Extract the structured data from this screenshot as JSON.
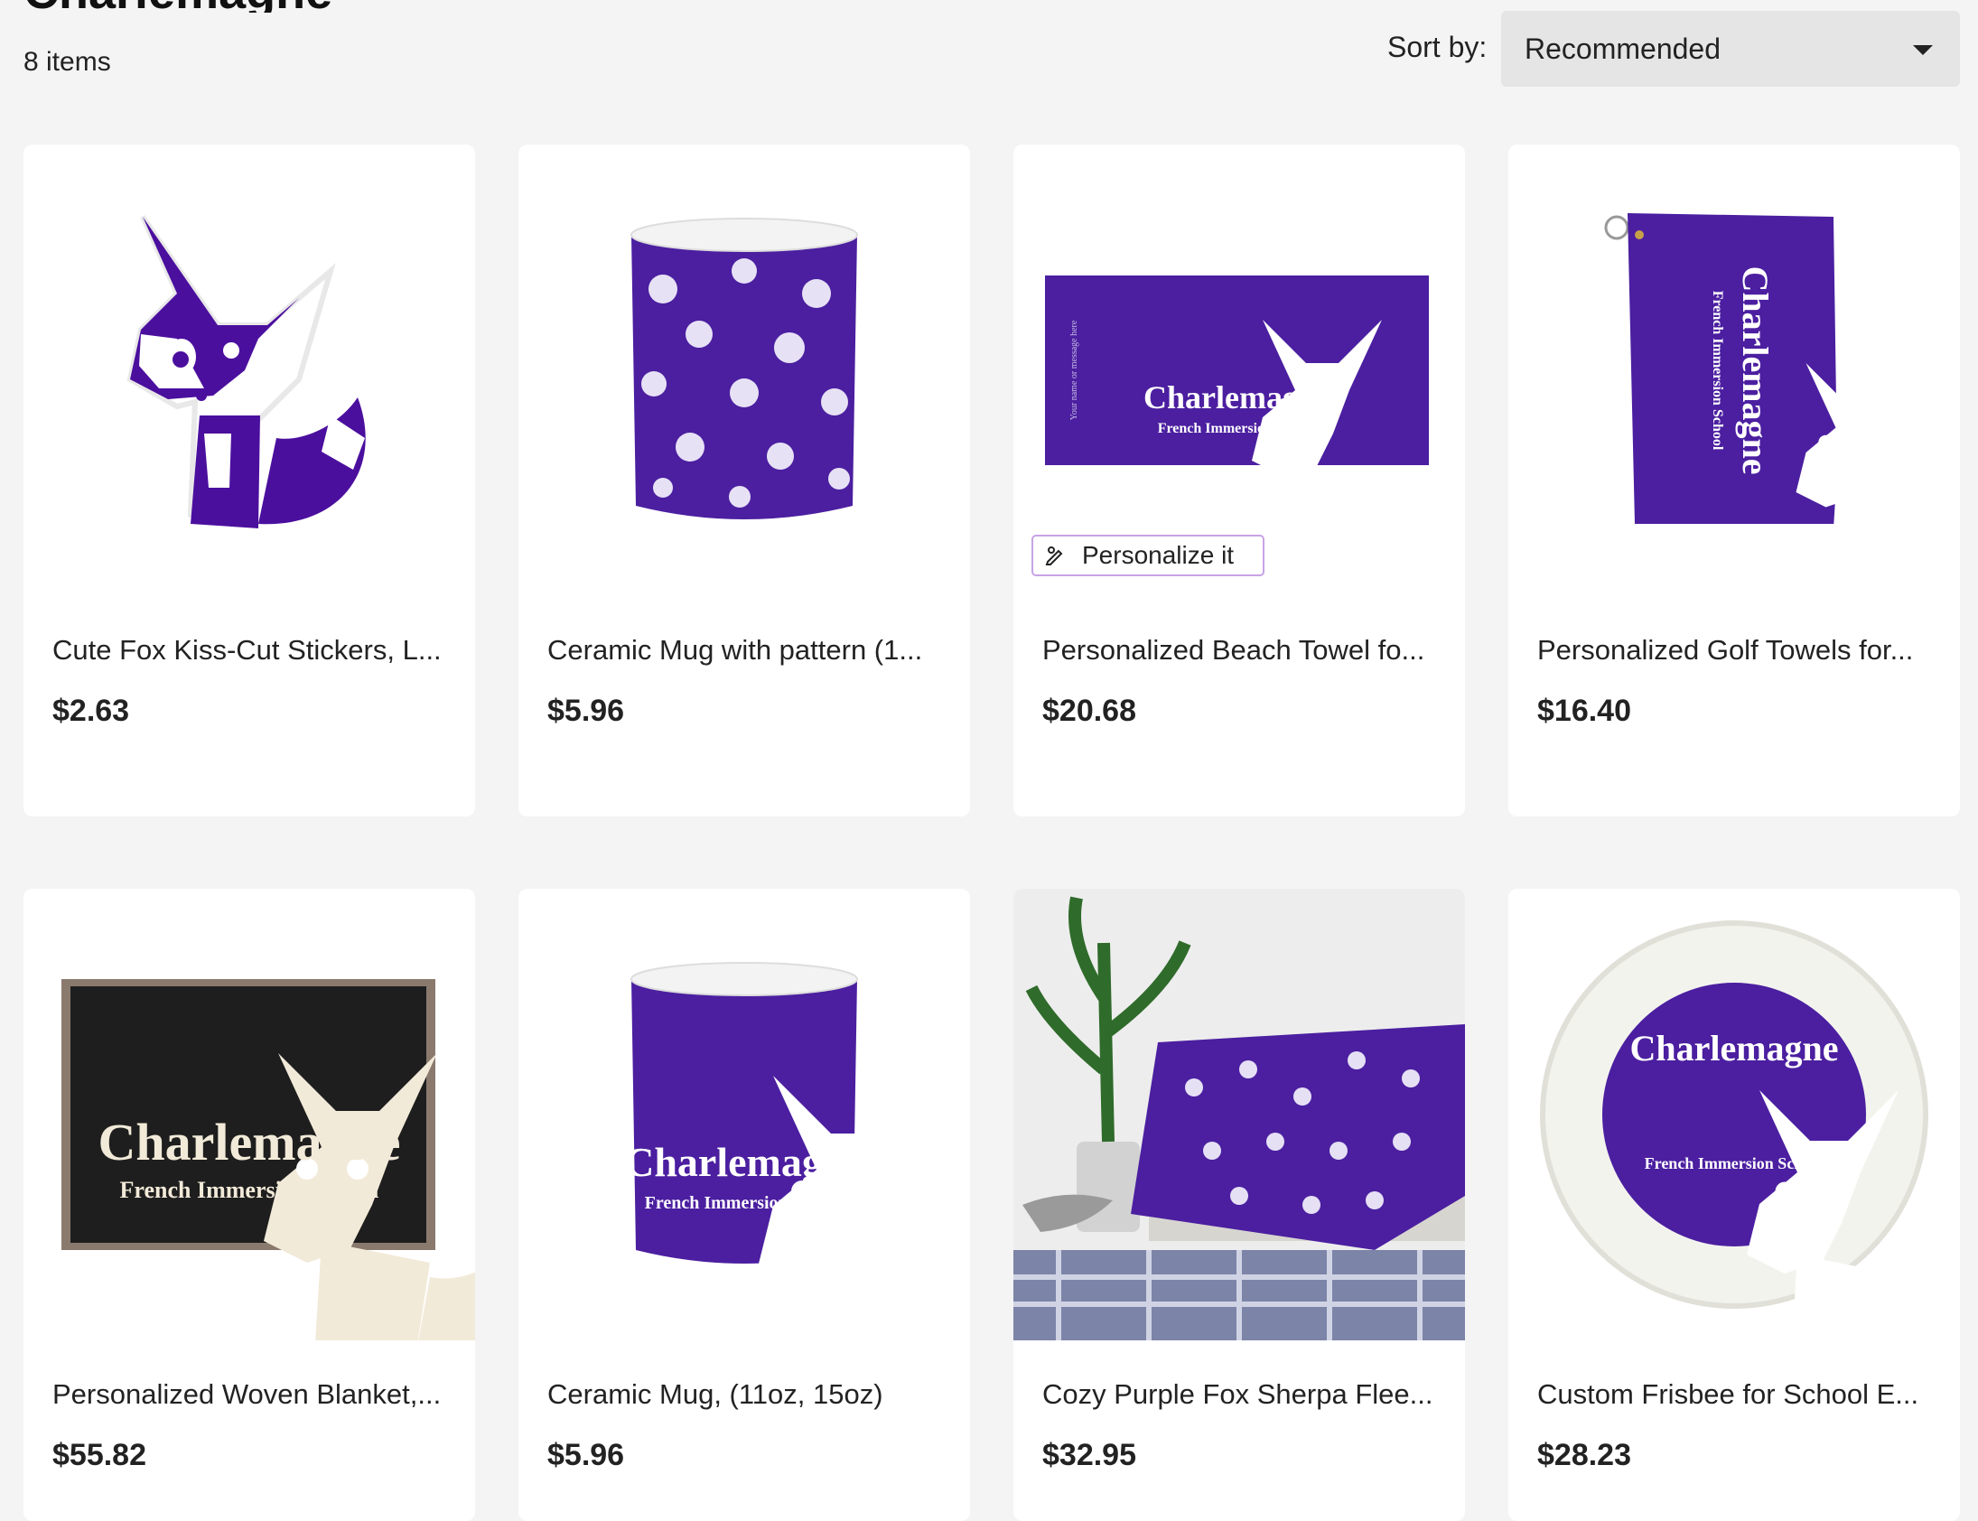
{
  "page": {
    "title": "Charlemagne",
    "item_count": "8 items",
    "sort_label": "Sort by:",
    "sort_value": "Recommended"
  },
  "colors": {
    "brand_purple": "#4b1fa0",
    "background": "#f4f4f4",
    "card": "#ffffff"
  },
  "products": [
    {
      "title": "Cute Fox Kiss-Cut Stickers, L...",
      "price": "$2.63",
      "image": "fox-sticker"
    },
    {
      "title": "Ceramic Mug with pattern (1...",
      "price": "$5.96",
      "image": "pattern-mug"
    },
    {
      "title": "Personalized Beach Towel fo...",
      "price": "$20.68",
      "image": "beach-towel",
      "badge": "Personalize it"
    },
    {
      "title": "Personalized Golf Towels for...",
      "price": "$16.40",
      "image": "golf-towel"
    },
    {
      "title": "Personalized Woven Blanket,...",
      "price": "$55.82",
      "image": "woven-blanket"
    },
    {
      "title": "Ceramic Mug, (11oz, 15oz)",
      "price": "$5.96",
      "image": "logo-mug"
    },
    {
      "title": "Cozy Purple Fox Sherpa Flee...",
      "price": "$32.95",
      "image": "sherpa-blanket"
    },
    {
      "title": "Custom Frisbee for School E...",
      "price": "$28.23",
      "image": "frisbee"
    }
  ],
  "logo": {
    "name": "Charlemagne",
    "subtitle": "French Immersion School",
    "towel_note": "Your name or message here"
  }
}
